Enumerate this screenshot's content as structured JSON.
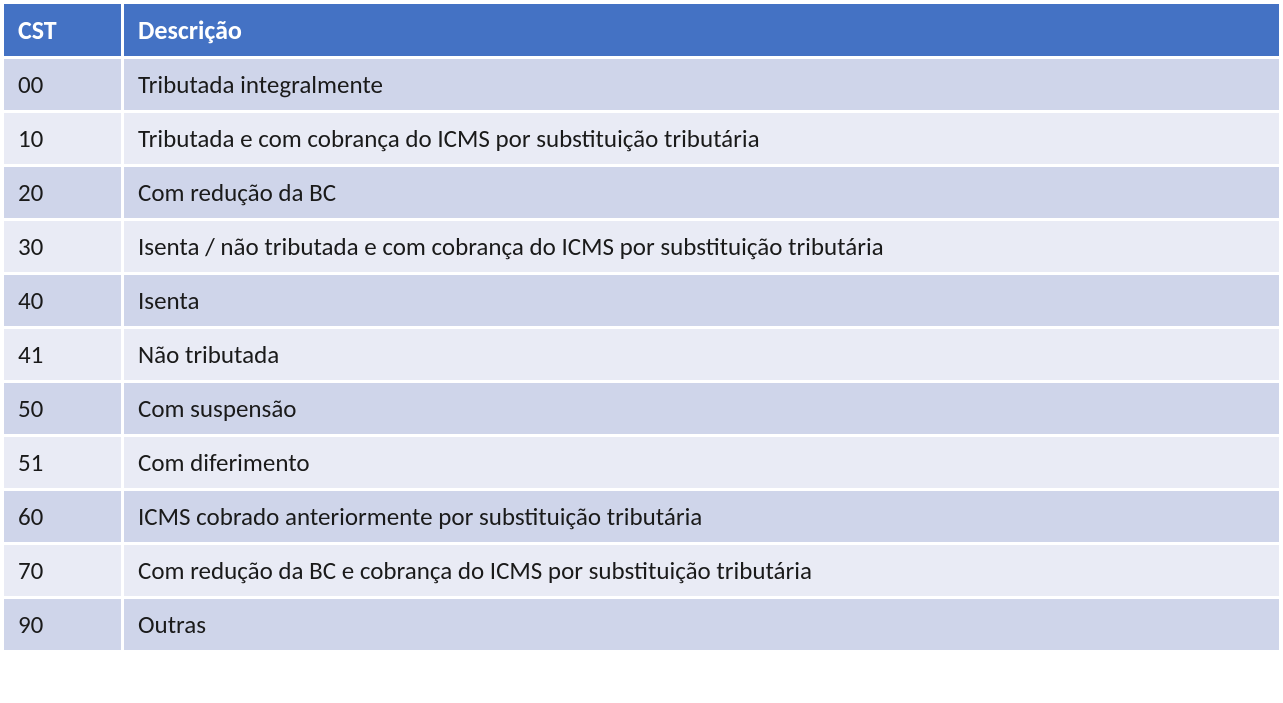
{
  "table": {
    "headers": {
      "cst": "CST",
      "descricao": "Descrição"
    },
    "rows": [
      {
        "cst": "00",
        "descricao": "Tributada integralmente"
      },
      {
        "cst": "10",
        "descricao": "Tributada e com cobrança do ICMS por substituição tributária"
      },
      {
        "cst": "20",
        "descricao": "Com redução da BC"
      },
      {
        "cst": "30",
        "descricao": "Isenta / não tributada e com cobrança do ICMS por substituição tributária"
      },
      {
        "cst": "40",
        "descricao": "Isenta"
      },
      {
        "cst": "41",
        "descricao": "Não tributada"
      },
      {
        "cst": "50",
        "descricao": "Com suspensão"
      },
      {
        "cst": "51",
        "descricao": "Com diferimento"
      },
      {
        "cst": "60",
        "descricao": "ICMS cobrado anteriormente por substituição tributária"
      },
      {
        "cst": "70",
        "descricao": "Com redução da BC e cobrança do ICMS por substituição tributária"
      },
      {
        "cst": "90",
        "descricao": "Outras"
      }
    ]
  }
}
